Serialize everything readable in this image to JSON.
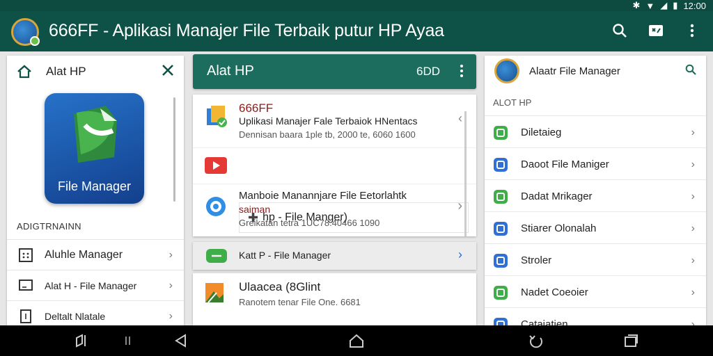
{
  "status": {
    "time": "12:00"
  },
  "appbar": {
    "title": "666FF - Aplikasi Manajer File Terbaik putur HP Ayaa"
  },
  "left": {
    "title": "Alat HP",
    "tile_label": "File Manager",
    "section": "ADIGTRNAINN",
    "items": [
      {
        "label": "Aluhle Manager"
      },
      {
        "label": "Alat H - File Manager"
      },
      {
        "label": "Deltalt Nlatale"
      }
    ]
  },
  "middle": {
    "header_title": "Alat HP",
    "header_count": "6DD",
    "rows": [
      {
        "title": "666FF",
        "line": "Uplikasi Manajer Fale Terbaiok HNentacs",
        "sub": "Dennisan baara 1ple tb, 2000 te, 6060 1600"
      },
      {
        "search": "hp - File Manger)"
      },
      {
        "line": "Manboie Manannjare File Eetorlahtk",
        "line2": "saiman",
        "sub": "Greikatan tetra 1UC78.40466 1090"
      }
    ],
    "bar_label": "Katt P - File Manager",
    "bottom_title": "Ulaacea (8Glint",
    "bottom_sub": "Ranotem tenar File One. 6681"
  },
  "right": {
    "title": "Alaatr File Manager",
    "section": "ALOT HP",
    "items": [
      {
        "label": "Diletaieg",
        "color": "#3fae48"
      },
      {
        "label": "Daoot File Maniger",
        "color": "#2f6fd6"
      },
      {
        "label": "Dadat Mrikager",
        "color": "#3fae48"
      },
      {
        "label": "Stiarer Olonalah",
        "color": "#2f6fd6"
      },
      {
        "label": "Stroler",
        "color": "#2f6fd6"
      },
      {
        "label": "Nadet Coeoier",
        "color": "#3fae48"
      },
      {
        "label": "Catajatien",
        "color": "#2f6fd6"
      }
    ]
  },
  "colors": {
    "appbar": "#0e5146",
    "accent": "#1d6d5f"
  }
}
